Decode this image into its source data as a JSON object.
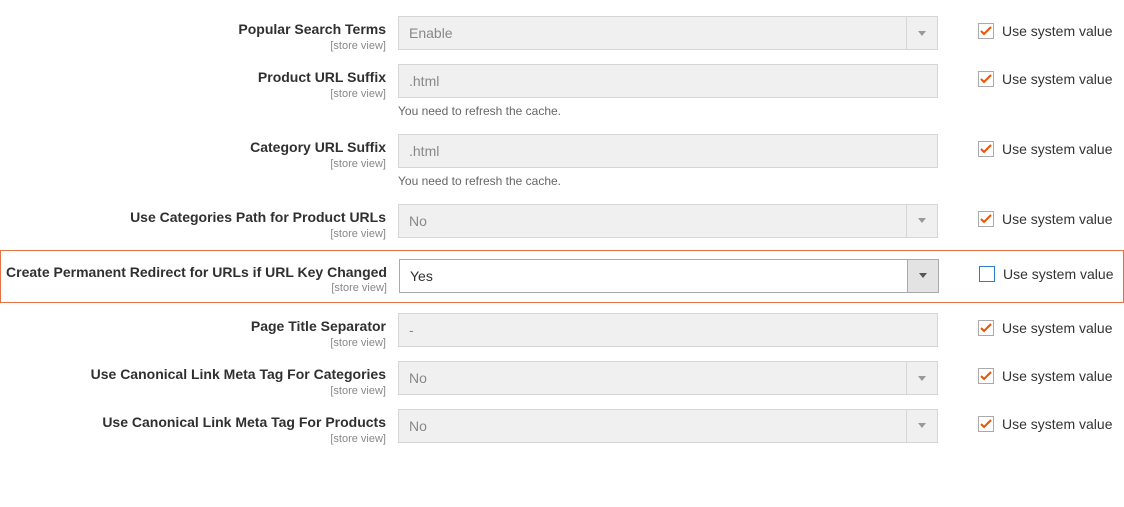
{
  "rows": [
    {
      "id": "popular-search-terms",
      "label": "Popular Search Terms",
      "scope": "[store view]",
      "type": "select",
      "value": "Enable",
      "disabled": true,
      "highlighted": false,
      "note": "",
      "use_system_checked": true
    },
    {
      "id": "product-url-suffix",
      "label": "Product URL Suffix",
      "scope": "[store view]",
      "type": "text",
      "value": ".html",
      "disabled": true,
      "highlighted": false,
      "note": "You need to refresh the cache.",
      "use_system_checked": true
    },
    {
      "id": "category-url-suffix",
      "label": "Category URL Suffix",
      "scope": "[store view]",
      "type": "text",
      "value": ".html",
      "disabled": true,
      "highlighted": false,
      "note": "You need to refresh the cache.",
      "use_system_checked": true
    },
    {
      "id": "use-categories-path",
      "label": "Use Categories Path for Product URLs",
      "scope": "[store view]",
      "type": "select",
      "value": "No",
      "disabled": true,
      "highlighted": false,
      "note": "",
      "use_system_checked": true
    },
    {
      "id": "create-permanent-redirect",
      "label": "Create Permanent Redirect for URLs if URL Key Changed",
      "scope": "[store view]",
      "type": "select",
      "value": "Yes",
      "disabled": false,
      "highlighted": true,
      "note": "",
      "use_system_checked": false
    },
    {
      "id": "page-title-separator",
      "label": "Page Title Separator",
      "scope": "[store view]",
      "type": "text",
      "value": "-",
      "disabled": true,
      "highlighted": false,
      "note": "",
      "use_system_checked": true
    },
    {
      "id": "canonical-categories",
      "label": "Use Canonical Link Meta Tag For Categories",
      "scope": "[store view]",
      "type": "select",
      "value": "No",
      "disabled": true,
      "highlighted": false,
      "note": "",
      "use_system_checked": true
    },
    {
      "id": "canonical-products",
      "label": "Use Canonical Link Meta Tag For Products",
      "scope": "[store view]",
      "type": "select",
      "value": "No",
      "disabled": true,
      "highlighted": false,
      "note": "",
      "use_system_checked": true
    }
  ],
  "use_system_label": "Use system value"
}
